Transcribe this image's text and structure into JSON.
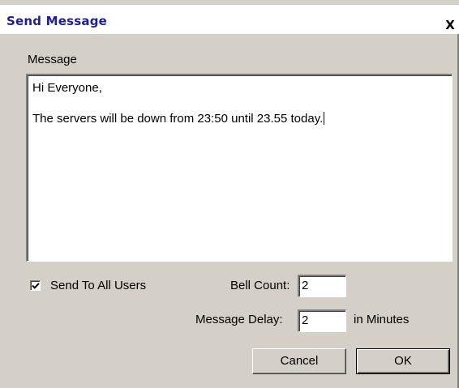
{
  "dialog": {
    "title": "Send Message",
    "close_glyph": "X"
  },
  "message": {
    "label": "Message",
    "lines": [
      "Hi Everyone,",
      "The servers will be down from 23:50 until 23.55 today."
    ]
  },
  "options": {
    "send_all_label": "Send To All Users",
    "send_all_checked": true,
    "bell_count_label": "Bell Count:",
    "bell_count_value": "2",
    "message_delay_label": "Message Delay:",
    "message_delay_value": "2",
    "message_delay_unit": "in Minutes"
  },
  "buttons": {
    "cancel_label": "Cancel",
    "ok_label": "OK"
  },
  "icons": {
    "close": "close-icon",
    "check": "checkmark-icon"
  }
}
